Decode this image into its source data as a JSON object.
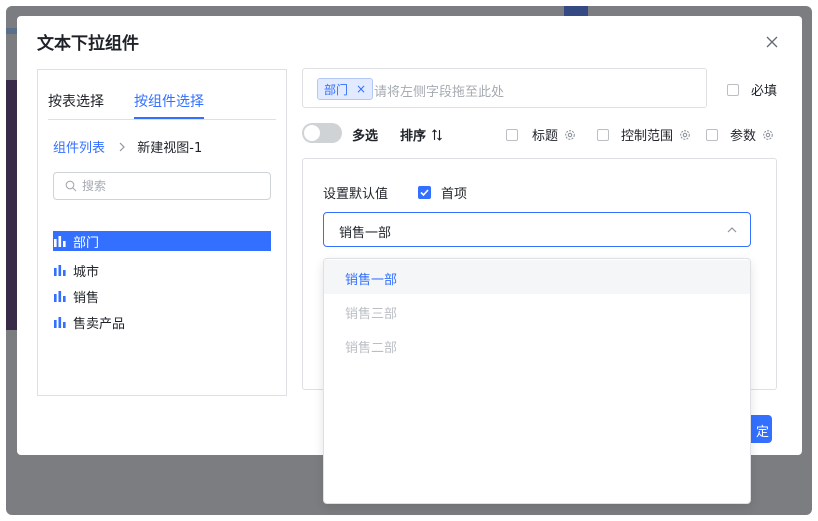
{
  "dialog": {
    "title": "文本下拉组件"
  },
  "left_panel": {
    "tabs": [
      {
        "label": "按表选择",
        "active": false
      },
      {
        "label": "按组件选择",
        "active": true
      }
    ],
    "breadcrumb": {
      "link": "组件列表",
      "current": "新建视图-1"
    },
    "search": {
      "placeholder": "搜索",
      "value": ""
    },
    "fields": [
      {
        "label": "部门",
        "icon": "bar-chart-icon",
        "selected": true
      },
      {
        "label": "城市",
        "icon": "bar-chart-icon",
        "selected": false
      },
      {
        "label": "销售",
        "icon": "bar-chart-icon",
        "selected": false
      },
      {
        "label": "售卖产品",
        "icon": "bar-chart-icon",
        "selected": false
      }
    ]
  },
  "drop_zone": {
    "tag": "部门",
    "tag_close": "×",
    "placeholder": "请将左侧字段拖至此处"
  },
  "options": {
    "required": "必填",
    "multi_select": "多选",
    "multi_select_on": false,
    "sort": "排序",
    "title": "标题",
    "control_range": "控制范围",
    "params": "参数"
  },
  "default_value": {
    "label": "设置默认值",
    "first_option": "首项",
    "first_option_checked": true,
    "selected": "销售一部"
  },
  "dropdown": {
    "items": [
      {
        "label": "销售一部",
        "active": true
      },
      {
        "label": "销售三部",
        "active": false
      },
      {
        "label": "销售二部",
        "active": false
      }
    ]
  },
  "footer": {
    "confirm_fragment": "定"
  },
  "colors": {
    "accent": "#3370ff",
    "text": "#1f2329",
    "muted": "#bbbfc4",
    "border": "#dee0e3"
  }
}
